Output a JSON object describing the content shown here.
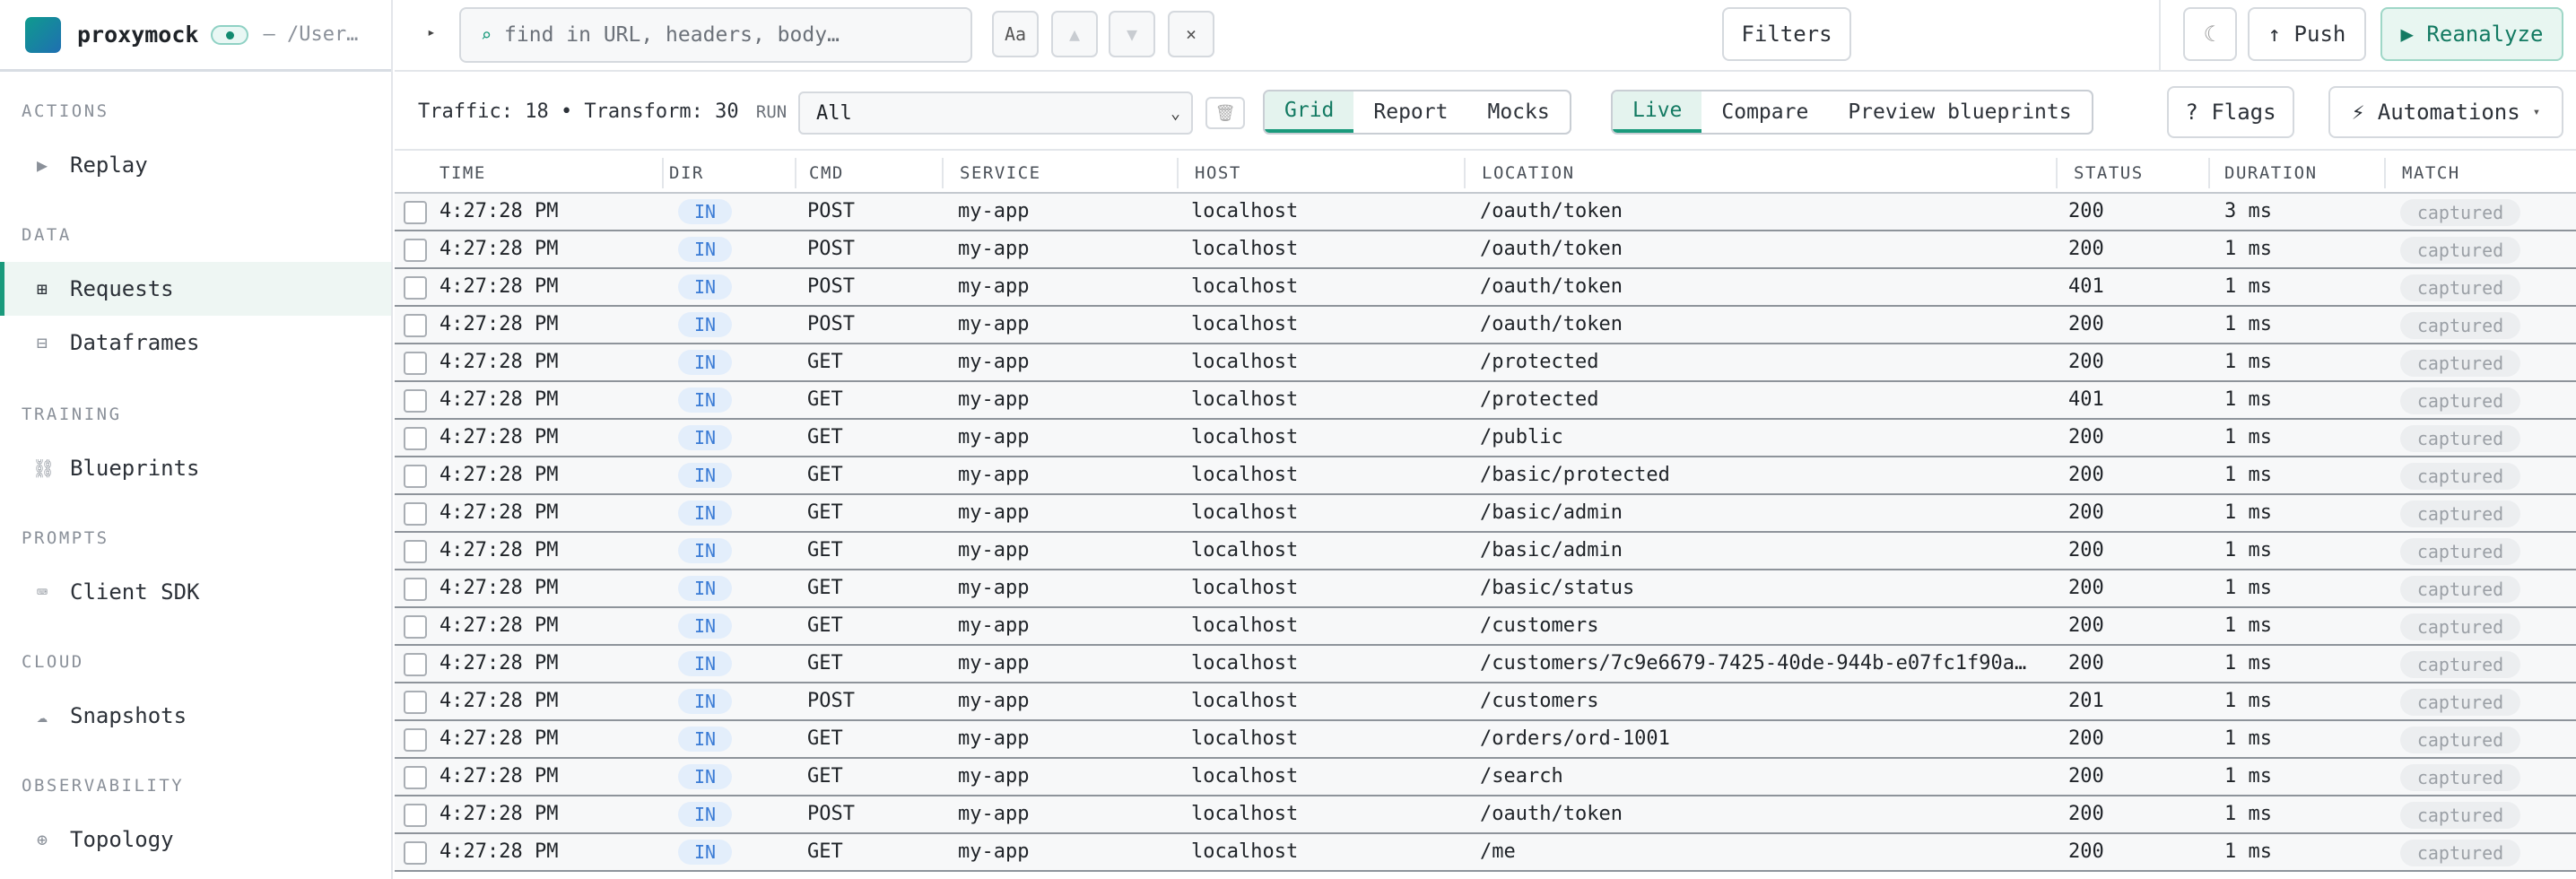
{
  "app": {
    "name": "proxymock",
    "path": "— /User…"
  },
  "sidebar": {
    "sections": [
      {
        "title": "ACTIONS",
        "items": [
          {
            "label": "Replay",
            "icon": "play-icon",
            "glyph": "▶"
          }
        ]
      },
      {
        "title": "DATA",
        "items": [
          {
            "label": "Requests",
            "icon": "grid-icon",
            "glyph": "⊞",
            "active": true
          },
          {
            "label": "Dataframes",
            "icon": "table-icon",
            "glyph": "⊟"
          }
        ]
      },
      {
        "title": "TRAINING",
        "items": [
          {
            "label": "Blueprints",
            "icon": "link-icon",
            "glyph": "⛓"
          }
        ]
      },
      {
        "title": "PROMPTS",
        "items": [
          {
            "label": "Client SDK",
            "icon": "keyboard-icon",
            "glyph": "⌨"
          }
        ]
      },
      {
        "title": "CLOUD",
        "items": [
          {
            "label": "Snapshots",
            "icon": "cloud-icon",
            "glyph": "☁"
          }
        ]
      },
      {
        "title": "OBSERVABILITY",
        "items": [
          {
            "label": "Topology",
            "icon": "globe-icon",
            "glyph": "⊕"
          }
        ]
      }
    ]
  },
  "topbar": {
    "search_placeholder": "find in URL, headers, body…",
    "case_label": "Aa",
    "prev_label": "▲",
    "next_label": "▼",
    "clear_label": "×",
    "filters_label": "Filters",
    "theme_label": "☾",
    "push_label": "↑ Push",
    "reanalyze_label": "▶ Reanalyze"
  },
  "toolbar": {
    "traffic_text": "Traffic: 18 • Transform: 30",
    "run_label": "RUN",
    "run_value": "All",
    "view_tabs": [
      "Grid",
      "Report",
      "Mocks"
    ],
    "view_selected": "Grid",
    "mode_tabs": [
      "Live",
      "Compare",
      "Preview blueprints"
    ],
    "mode_selected": "Live",
    "flags_label": "? Flags",
    "automations_label": "⚡ Automations"
  },
  "table": {
    "columns": [
      "TIME",
      "DIR",
      "CMD",
      "SERVICE",
      "HOST",
      "LOCATION",
      "STATUS",
      "DURATION",
      "MATCH"
    ],
    "rows": [
      {
        "time": "4:27:28 PM",
        "dir": "IN",
        "cmd": "POST",
        "service": "my-app",
        "host": "localhost",
        "location": "/oauth/token",
        "status": "200",
        "duration": "3 ms",
        "match": "captured"
      },
      {
        "time": "4:27:28 PM",
        "dir": "IN",
        "cmd": "POST",
        "service": "my-app",
        "host": "localhost",
        "location": "/oauth/token",
        "status": "200",
        "duration": "1 ms",
        "match": "captured"
      },
      {
        "time": "4:27:28 PM",
        "dir": "IN",
        "cmd": "POST",
        "service": "my-app",
        "host": "localhost",
        "location": "/oauth/token",
        "status": "401",
        "duration": "1 ms",
        "match": "captured"
      },
      {
        "time": "4:27:28 PM",
        "dir": "IN",
        "cmd": "POST",
        "service": "my-app",
        "host": "localhost",
        "location": "/oauth/token",
        "status": "200",
        "duration": "1 ms",
        "match": "captured"
      },
      {
        "time": "4:27:28 PM",
        "dir": "IN",
        "cmd": "GET",
        "service": "my-app",
        "host": "localhost",
        "location": "/protected",
        "status": "200",
        "duration": "1 ms",
        "match": "captured"
      },
      {
        "time": "4:27:28 PM",
        "dir": "IN",
        "cmd": "GET",
        "service": "my-app",
        "host": "localhost",
        "location": "/protected",
        "status": "401",
        "duration": "1 ms",
        "match": "captured"
      },
      {
        "time": "4:27:28 PM",
        "dir": "IN",
        "cmd": "GET",
        "service": "my-app",
        "host": "localhost",
        "location": "/public",
        "status": "200",
        "duration": "1 ms",
        "match": "captured"
      },
      {
        "time": "4:27:28 PM",
        "dir": "IN",
        "cmd": "GET",
        "service": "my-app",
        "host": "localhost",
        "location": "/basic/protected",
        "status": "200",
        "duration": "1 ms",
        "match": "captured"
      },
      {
        "time": "4:27:28 PM",
        "dir": "IN",
        "cmd": "GET",
        "service": "my-app",
        "host": "localhost",
        "location": "/basic/admin",
        "status": "200",
        "duration": "1 ms",
        "match": "captured"
      },
      {
        "time": "4:27:28 PM",
        "dir": "IN",
        "cmd": "GET",
        "service": "my-app",
        "host": "localhost",
        "location": "/basic/admin",
        "status": "200",
        "duration": "1 ms",
        "match": "captured"
      },
      {
        "time": "4:27:28 PM",
        "dir": "IN",
        "cmd": "GET",
        "service": "my-app",
        "host": "localhost",
        "location": "/basic/status",
        "status": "200",
        "duration": "1 ms",
        "match": "captured"
      },
      {
        "time": "4:27:28 PM",
        "dir": "IN",
        "cmd": "GET",
        "service": "my-app",
        "host": "localhost",
        "location": "/customers",
        "status": "200",
        "duration": "1 ms",
        "match": "captured"
      },
      {
        "time": "4:27:28 PM",
        "dir": "IN",
        "cmd": "GET",
        "service": "my-app",
        "host": "localhost",
        "location": "/customers/7c9e6679-7425-40de-944b-e07fc1f90a…",
        "status": "200",
        "duration": "1 ms",
        "match": "captured"
      },
      {
        "time": "4:27:28 PM",
        "dir": "IN",
        "cmd": "POST",
        "service": "my-app",
        "host": "localhost",
        "location": "/customers",
        "status": "201",
        "duration": "1 ms",
        "match": "captured"
      },
      {
        "time": "4:27:28 PM",
        "dir": "IN",
        "cmd": "GET",
        "service": "my-app",
        "host": "localhost",
        "location": "/orders/ord-1001",
        "status": "200",
        "duration": "1 ms",
        "match": "captured"
      },
      {
        "time": "4:27:28 PM",
        "dir": "IN",
        "cmd": "GET",
        "service": "my-app",
        "host": "localhost",
        "location": "/search",
        "status": "200",
        "duration": "1 ms",
        "match": "captured"
      },
      {
        "time": "4:27:28 PM",
        "dir": "IN",
        "cmd": "POST",
        "service": "my-app",
        "host": "localhost",
        "location": "/oauth/token",
        "status": "200",
        "duration": "1 ms",
        "match": "captured"
      },
      {
        "time": "4:27:28 PM",
        "dir": "IN",
        "cmd": "GET",
        "service": "my-app",
        "host": "localhost",
        "location": "/me",
        "status": "200",
        "duration": "1 ms",
        "match": "captured"
      }
    ]
  },
  "colors": {
    "accent": "#1a9a7c",
    "dir_badge": "#3a7bd5"
  }
}
